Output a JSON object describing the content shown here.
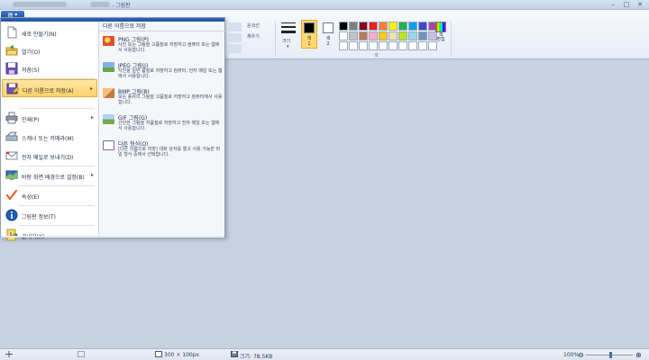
{
  "titlebar": {
    "title": "- 그림판",
    "controls": {
      "minimize": "–",
      "maximize": "□",
      "close": "✕"
    }
  },
  "ribbon": {
    "menu_button": "▤ ▾",
    "shapes": {
      "outline": "윤곽선",
      "fill": "채우기"
    },
    "size_label": "크기",
    "color1": {
      "label": "색\n1",
      "value": "#000000"
    },
    "color2": {
      "label": "색\n2",
      "value": "#ffffff"
    },
    "color_group": "색",
    "edit_colors": "색\n편집",
    "palette": [
      "#000000",
      "#7f7f7f",
      "#880015",
      "#ed1c24",
      "#ff7f27",
      "#fff200",
      "#22b14c",
      "#00a2e8",
      "#3f48cc",
      "#a349a4",
      "#ffffff",
      "#c3c3c3",
      "#b97a57",
      "#ffaec9",
      "#ffc90e",
      "#efe4b0",
      "#b5e61d",
      "#99d9ea",
      "#7092be",
      "#c8bfe7",
      "#ffffff",
      "#ffffff",
      "#ffffff",
      "#ffffff",
      "#ffffff",
      "#ffffff",
      "#ffffff",
      "#ffffff",
      "#ffffff",
      "#ffffff"
    ]
  },
  "menu": {
    "items": [
      {
        "label": "새로 만들기(N)",
        "icon": "new-document-icon",
        "arrow": ""
      },
      {
        "label": "열기(O)",
        "icon": "open-folder-icon",
        "arrow": ""
      },
      {
        "label": "저장(S)",
        "icon": "save-disk-icon",
        "arrow": ""
      },
      {
        "label": "다른 이름으로 저장(A)",
        "icon": "save-as-icon",
        "arrow": "▸"
      },
      {
        "label": "인쇄(P)",
        "icon": "printer-icon",
        "arrow": "▸"
      },
      {
        "label": "스캐너 또는 카메라(M)",
        "icon": "scanner-icon",
        "arrow": ""
      },
      {
        "label": "전자 메일로 보내기(D)",
        "icon": "email-icon",
        "arrow": ""
      },
      {
        "label": "바탕 화면 배경으로 설정(B)",
        "icon": "desktop-background-icon",
        "arrow": "▸"
      },
      {
        "label": "속성(E)",
        "icon": "checkmark-icon",
        "arrow": ""
      },
      {
        "label": "그림판 정보(T)",
        "icon": "info-icon",
        "arrow": ""
      },
      {
        "label": "끝내기(X)",
        "icon": "exit-icon",
        "arrow": ""
      }
    ],
    "submenu": {
      "header": "다른 이름으로 저장",
      "items": [
        {
          "title": "PNG 그림(P)",
          "desc": "사진 또는 그림을 고품질로 저장하고 컴퓨터 또는 웹에서 사용합니다.",
          "icon": "png-image-icon",
          "color": "#d9532c"
        },
        {
          "title": "JPEG 그림(J)",
          "desc": "사진을 일반 품질로 저장하고 컴퓨터, 전자 메일 또는 웹에서 사용합니다.",
          "icon": "jpeg-image-icon",
          "color": "#5d8fc9"
        },
        {
          "title": "BMP 그림(B)",
          "desc": "모든 종류의 그림을 고품질로 저장하고 컴퓨터에서 사용합니다.",
          "icon": "bmp-image-icon",
          "color": "#c97a3a"
        },
        {
          "title": "GIF 그림(G)",
          "desc": "간단한 그림을 저품질로 저장하고 전자 메일 또는 웹에서 사용합니다.",
          "icon": "gif-image-icon",
          "color": "#7aa84a"
        },
        {
          "title": "다른 형식(O)",
          "desc": "[다른 이름으로 저장] 대화 상자를 열고 사용 가능한 파일 형식 중에서 선택합니다.",
          "icon": "other-format-icon",
          "color": "#7c6aa8"
        }
      ]
    }
  },
  "status": {
    "dimensions": "300 × 100px",
    "file_size": "크기: 78.5KB",
    "zoom": "100%",
    "zoom_minus": "⊖",
    "zoom_plus": "⊕"
  }
}
